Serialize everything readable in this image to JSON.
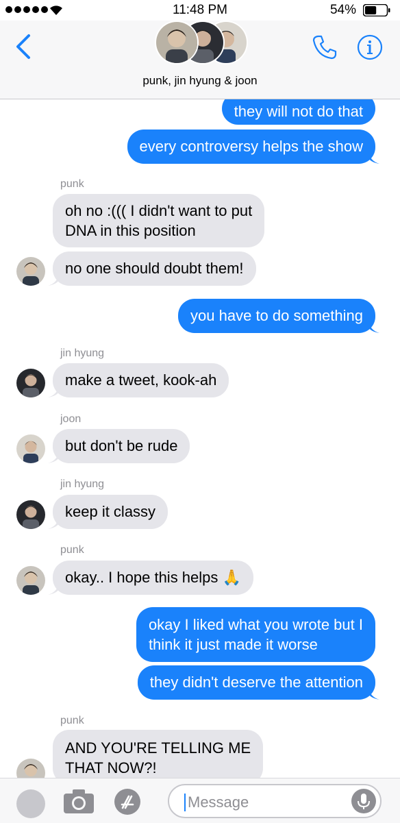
{
  "status_bar": {
    "time": "11:48 PM",
    "battery_percent": "54%",
    "battery_level": 0.54,
    "signal_dots": 5
  },
  "header": {
    "title": "punk, jin hyung & joon"
  },
  "messages": [
    {
      "side": "out",
      "text": "they will not do that"
    },
    {
      "side": "out",
      "text": "every controversy helps the show"
    },
    {
      "side": "in",
      "sender": "punk",
      "lines": [
        "oh no :((( I didn't want to put",
        "DNA in this position"
      ]
    },
    {
      "side": "in",
      "text": "no one should doubt them!"
    },
    {
      "side": "out",
      "text": "you have to do something"
    },
    {
      "side": "in",
      "sender": "jin hyung",
      "text": "make a tweet, kook-ah"
    },
    {
      "side": "in",
      "sender": "joon",
      "text": "but don't be rude"
    },
    {
      "side": "in",
      "sender": "jin hyung",
      "text": "keep it classy"
    },
    {
      "side": "in",
      "sender": "punk",
      "text": "okay.. I hope this helps 🙏"
    },
    {
      "side": "out",
      "lines": [
        "okay I liked what you wrote but I",
        "think it just made it worse"
      ]
    },
    {
      "side": "out",
      "text": "they didn't deserve the attention"
    },
    {
      "side": "in",
      "sender": "punk",
      "lines": [
        "AND YOU'RE TELLING ME",
        "THAT NOW?!"
      ]
    }
  ],
  "input": {
    "placeholder": "Message"
  },
  "colors": {
    "outgoing_bubble": "#1a82fb",
    "incoming_bubble": "#e5e5ea",
    "accent": "#1a82fb"
  }
}
